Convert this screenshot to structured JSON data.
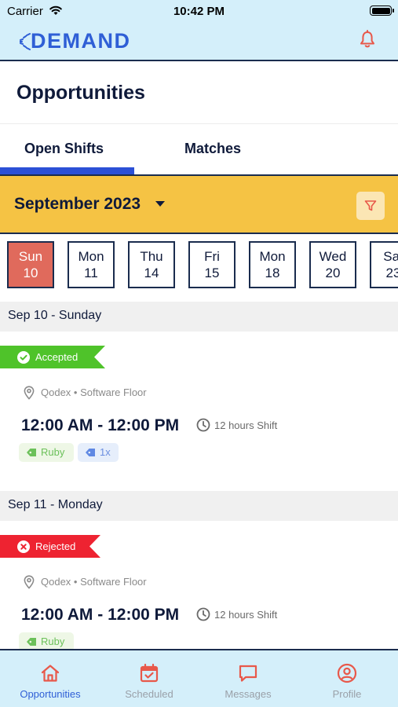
{
  "status_bar": {
    "carrier": "Carrier",
    "time": "10:42 PM"
  },
  "header": {
    "logo_text": "DEMAND",
    "bell_icon": "bell-icon"
  },
  "page": {
    "title": "Opportunities"
  },
  "tabs": [
    {
      "label": "Open Shifts",
      "active": true
    },
    {
      "label": "Matches",
      "active": false
    }
  ],
  "month_selector": {
    "label": "September 2023",
    "filter_icon": "filter-icon"
  },
  "days": [
    {
      "name": "Sun",
      "date": "10",
      "selected": true
    },
    {
      "name": "Mon",
      "date": "11",
      "selected": false
    },
    {
      "name": "Thu",
      "date": "14",
      "selected": false
    },
    {
      "name": "Fri",
      "date": "15",
      "selected": false
    },
    {
      "name": "Mon",
      "date": "18",
      "selected": false
    },
    {
      "name": "Wed",
      "date": "20",
      "selected": false
    },
    {
      "name": "Sat",
      "date": "23",
      "selected": false
    }
  ],
  "sections": [
    {
      "date_label": "Sep 10 - Sunday",
      "shifts": [
        {
          "status": "Accepted",
          "status_color": "#4fc32a",
          "location": "Qodex • Software Floor",
          "time_range": "12:00 AM - 12:00 PM",
          "duration": "12 hours Shift",
          "tags": [
            {
              "label": "Ruby",
              "style": "green"
            },
            {
              "label": "1x",
              "style": "blue"
            }
          ]
        }
      ]
    },
    {
      "date_label": "Sep 11 - Monday",
      "shifts": [
        {
          "status": "Rejected",
          "status_color": "#ee2331",
          "location": "Qodex • Software Floor",
          "time_range": "12:00 AM - 12:00 PM",
          "duration": "12 hours Shift",
          "tags": [
            {
              "label": "Ruby",
              "style": "green"
            }
          ]
        }
      ]
    }
  ],
  "bottom_nav": [
    {
      "label": "Opportunities",
      "icon": "home-icon",
      "active": true
    },
    {
      "label": "Scheduled",
      "icon": "calendar-icon",
      "active": false
    },
    {
      "label": "Messages",
      "icon": "message-icon",
      "active": false
    },
    {
      "label": "Profile",
      "icon": "user-icon",
      "active": false
    }
  ],
  "colors": {
    "header_bg": "#d4effa",
    "brand_blue": "#2f5fd6",
    "month_bar": "#f5c344",
    "selected_day": "#e06a5c",
    "accent_red": "#e8584a",
    "navy": "#0f1a3a"
  }
}
